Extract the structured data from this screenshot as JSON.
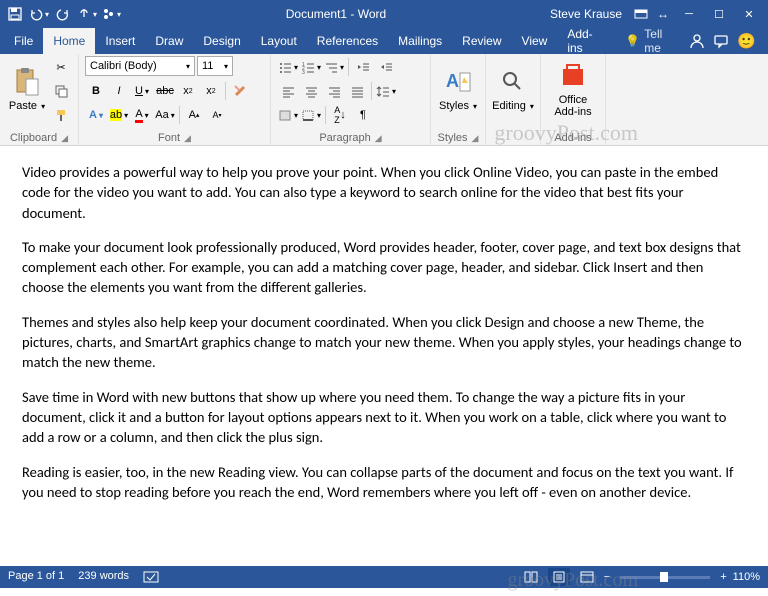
{
  "title": "Document1 - Word",
  "user": "Steve Krause",
  "tabs": [
    "File",
    "Home",
    "Insert",
    "Draw",
    "Design",
    "Layout",
    "References",
    "Mailings",
    "Review",
    "View",
    "Add-ins"
  ],
  "tellme": "Tell me",
  "ribbon": {
    "clipboard": {
      "label": "Clipboard",
      "paste": "Paste"
    },
    "font": {
      "label": "Font",
      "name": "Calibri (Body)",
      "size": "11"
    },
    "paragraph": {
      "label": "Paragraph"
    },
    "styles": {
      "label": "Styles",
      "btn": "Styles"
    },
    "editing": {
      "label": "",
      "btn": "Editing"
    },
    "addins": {
      "label": "Add-ins",
      "btn": "Office\nAdd-ins"
    }
  },
  "doc": {
    "p1": "Video provides a powerful way to help you prove your point. When you click Online Video, you can paste in the embed code for the video you want to add. You can also type a keyword to search online for the video that best fits your document.",
    "p2": "To make your document look professionally produced, Word provides header, footer, cover page, and text box designs that complement each other. For example, you can add a matching cover page, header, and sidebar. Click Insert and then choose the elements you want from the different galleries.",
    "p3": "Themes and styles also help keep your document coordinated. When you click Design and choose a new Theme, the pictures, charts, and SmartArt graphics change to match your new theme. When you apply styles, your headings change to match the new theme.",
    "p4": "Save time in Word with new buttons that show up where you need them. To change the way a picture fits in your document, click it and a button for layout options appears next to it. When you work on a table, click where you want to add a row or a column, and then click the plus sign.",
    "p5": "Reading is easier, too, in the new Reading view. You can collapse parts of the document and focus on the text you want. If you need to stop reading before you reach the end, Word remembers where you left off - even on another device."
  },
  "status": {
    "page": "Page 1 of 1",
    "words": "239 words",
    "zoom": "110%"
  },
  "watermark1": "groovyPost.com",
  "watermark2": "groovyPost.com"
}
